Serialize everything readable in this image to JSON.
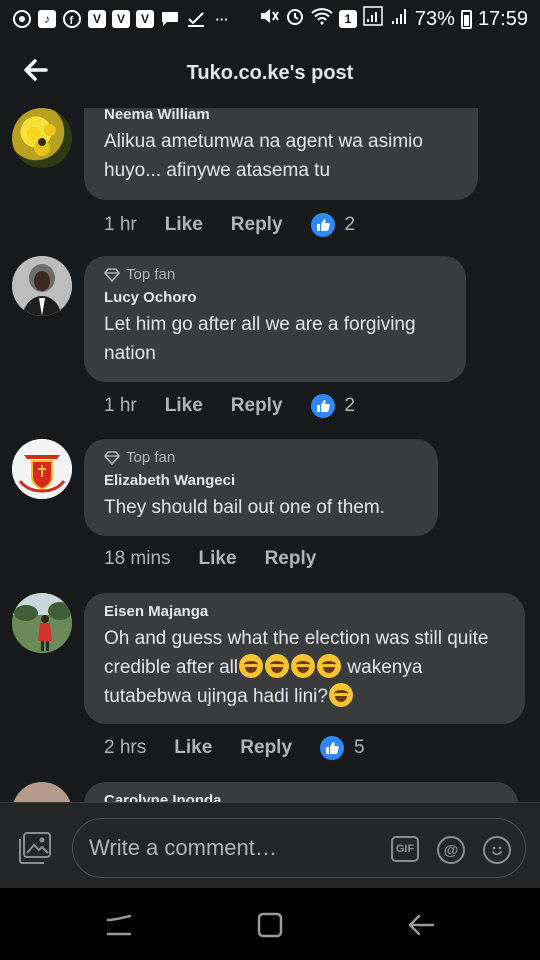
{
  "status_bar": {
    "battery": "73%",
    "time": "17:59",
    "sim": "1",
    "left_icons": [
      "chrome-icon",
      "tiktok-icon",
      "facebook-icon",
      "vpn-icon",
      "vpn-icon",
      "vpn-icon",
      "chat-icon",
      "check-icon"
    ],
    "more": "···"
  },
  "header": {
    "title": "Tuko.co.ke's post"
  },
  "comments": [
    {
      "name": "Neema William",
      "top_fan": "",
      "text": "Alikua ametumwa na agent wa asimio huyo... afinywe atasema tu",
      "time": "1 hr",
      "like": "Like",
      "reply": "Reply",
      "reactions": "2"
    },
    {
      "name": "Lucy Ochoro",
      "top_fan": "Top fan",
      "text": "Let him go after all we are a forgiving nation",
      "time": "1 hr",
      "like": "Like",
      "reply": "Reply",
      "reactions": "2"
    },
    {
      "name": "Elizabeth Wangeci",
      "top_fan": "Top fan",
      "text": "They should bail out one of them.",
      "time": "18 mins",
      "like": "Like",
      "reply": "Reply",
      "reactions": ""
    },
    {
      "name": "Eisen Majanga",
      "top_fan": "",
      "text_part1": "Oh and guess what the election was still quite credible after all",
      "text_part2": " wakenya tutabebwa ujinga hadi lini?",
      "emojis": [
        "laughing-crying-emoji",
        "laughing-crying-emoji",
        "laughing-crying-emoji",
        "laughing-crying-emoji",
        "smirk-emoji"
      ],
      "time": "2 hrs",
      "like": "Like",
      "reply": "Reply",
      "reactions": "5"
    },
    {
      "name": "Carolyne Inonda",
      "top_fan": ""
    }
  ],
  "composer": {
    "placeholder": "Write a comment…",
    "gif_label": "GIF",
    "mention_symbol": "@"
  },
  "colors": {
    "background": "#18191a",
    "bubble": "#3a3b3c",
    "like_blue": "#2e89ff",
    "muted_text": "#b0b3b8"
  }
}
